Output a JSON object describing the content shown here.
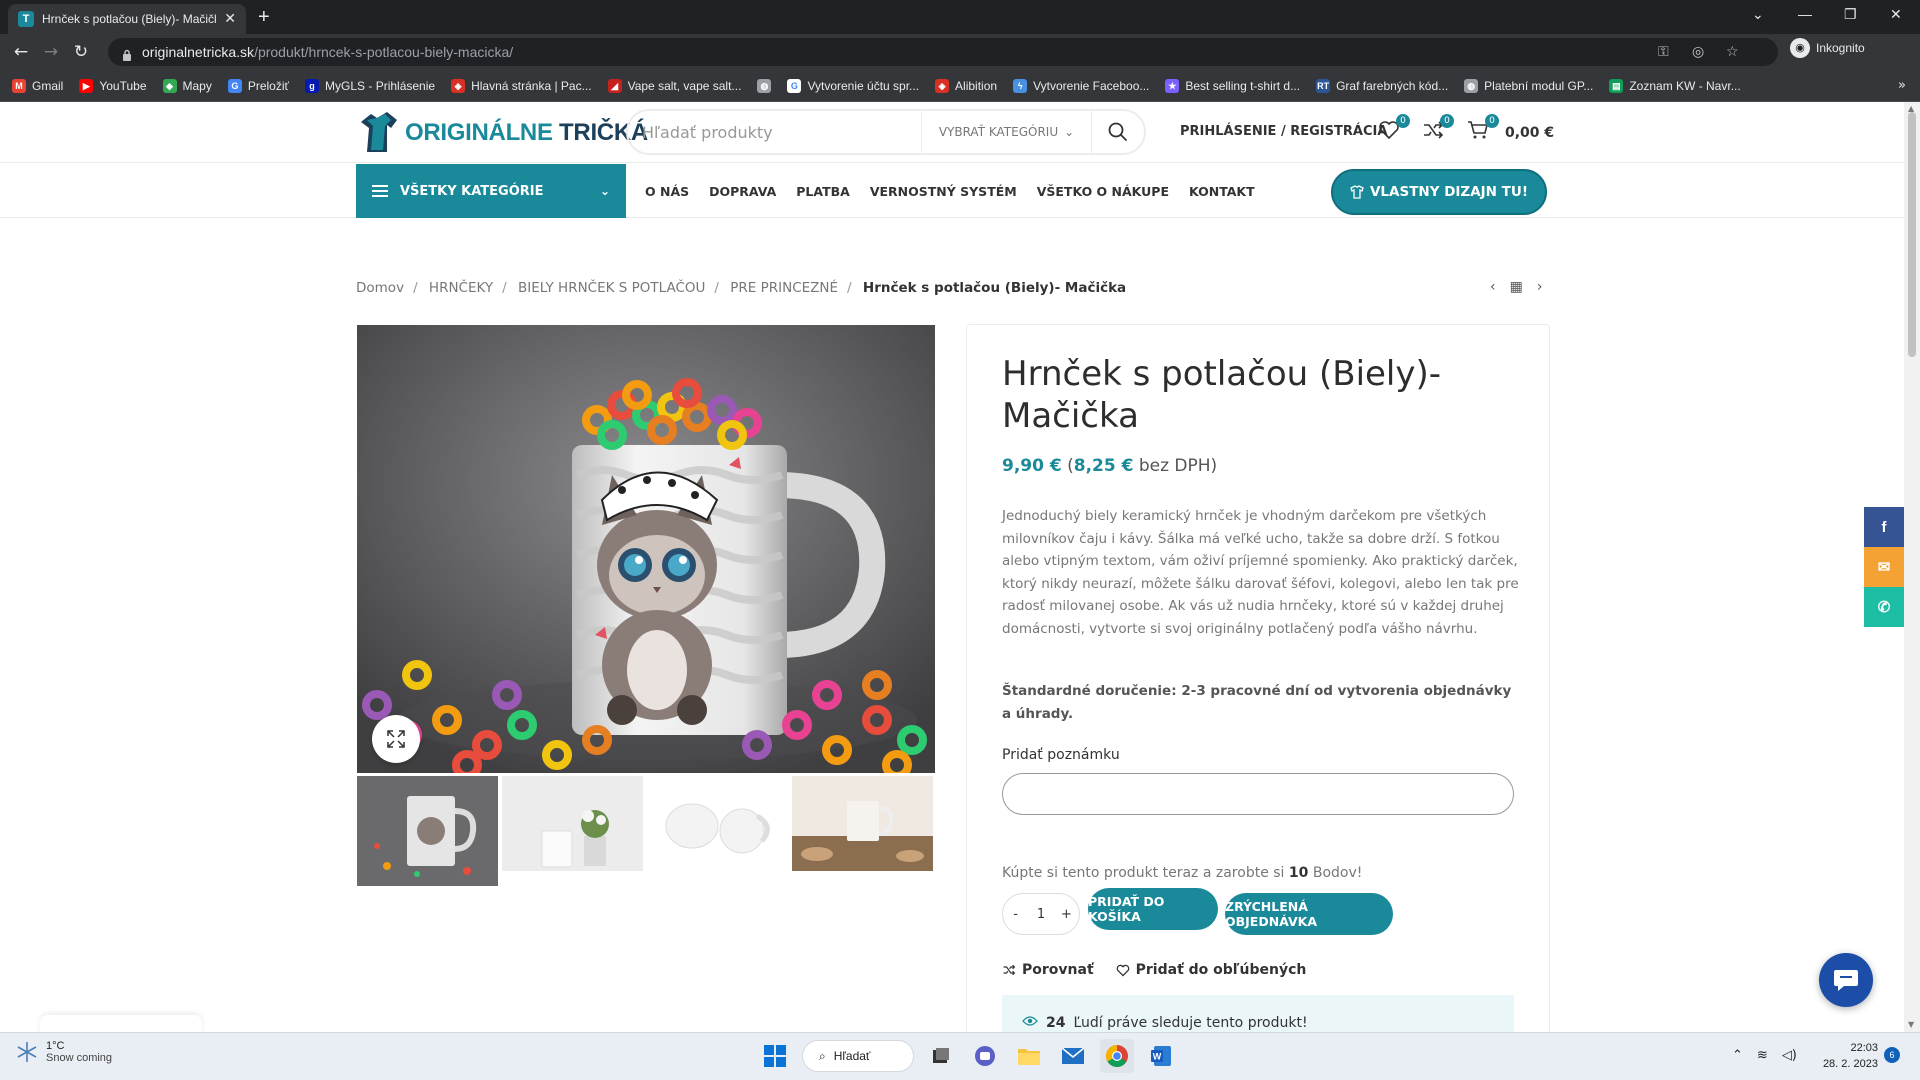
{
  "browser": {
    "tab_title": "Hrnček s potlačou (Biely)- Mačičk",
    "url_host": "originalnetricka.sk",
    "url_path": "/produkt/hrncek-s-potlacou-biely-macicka/",
    "profile_label": "Inkognito",
    "bookmarks": [
      {
        "label": "Gmail",
        "icon": "gmail-icon",
        "color": "#ea4335"
      },
      {
        "label": "YouTube",
        "icon": "youtube-icon",
        "color": "#ff0000"
      },
      {
        "label": "Mapy",
        "icon": "maps-icon",
        "color": "#34a853"
      },
      {
        "label": "Preložiť",
        "icon": "translate-icon",
        "color": "#4285f4"
      },
      {
        "label": "MyGLS - Prihlásenie",
        "icon": "gls-icon",
        "color": "#061ab1"
      },
      {
        "label": "Hlavná stránka | Pac...",
        "icon": "shield-icon",
        "color": "#d93025"
      },
      {
        "label": "Vape salt, vape salt...",
        "icon": "vape-icon",
        "color": "#c5221f"
      },
      {
        "label": "",
        "icon": "globe-icon",
        "color": "#9aa0a6"
      },
      {
        "label": "Vytvorenie účtu spr...",
        "icon": "google-icon",
        "color": "#ffffff"
      },
      {
        "label": "Alibition",
        "icon": "shield-icon",
        "color": "#d93025"
      },
      {
        "label": "Vytvorenie Faceboo...",
        "icon": "bolt-icon",
        "color": "#4a90e2"
      },
      {
        "label": "Best selling t-shirt d...",
        "icon": "star-icon",
        "color": "#7b61ff"
      },
      {
        "label": "Graf farebných kód...",
        "icon": "rt-icon",
        "color": "#2b5797"
      },
      {
        "label": "Platební modul GP...",
        "icon": "globe-icon",
        "color": "#9aa0a6"
      },
      {
        "label": "Zoznam KW - Navr...",
        "icon": "sheets-icon",
        "color": "#0f9d58"
      }
    ]
  },
  "header": {
    "logo_part1": "ORIGINÁLNE",
    "logo_part2": "TRIČKÁ",
    "search_placeholder": "Hľadať produkty",
    "category_select": "VYBRAŤ KATEGÓRIU",
    "login": "PRIHLÁSENIE / REGISTRÁCIA",
    "wishlist_count": "0",
    "compare_count": "0",
    "cart_count": "0",
    "cart_total": "0,00 €"
  },
  "nav": {
    "all_categories": "VŠETKY KATEGÓRIE",
    "menu": [
      "O NÁS",
      "DOPRAVA",
      "PLATBA",
      "VERNOSTNÝ SYSTÉM",
      "VŠETKO O NÁKUPE",
      "KONTAKT"
    ],
    "cta": "VLASTNY DIZAJN TU!"
  },
  "breadcrumb": {
    "items": [
      "Domov",
      "HRNČEKY",
      "BIELY HRNČEK S POTLAČOU",
      "PRE PRINCEZNÉ"
    ],
    "current": "Hrnček s potlačou (Biely)- Mačička"
  },
  "product": {
    "title": "Hrnček s potlačou (Biely)- Mačička",
    "price": "9,90 €",
    "price_net": "8,25 €",
    "price_net_suffix": "bez DPH)",
    "price_open": "(",
    "description": "Jednoduchý biely keramický hrnček je vhodným darčekom pre všetkých milovníkov čaju i kávy. Šálka má veľké ucho, takže sa dobre drží. S fotkou alebo vtipným textom, vám oživí príjemné spomienky. Ako praktický darček, ktorý nikdy neurazí, môžete šálku darovať šéfovi, kolegovi, alebo len tak pre radosť milovanej osobe. Ak vás už nudia hrnčeky, ktoré sú v každej druhej domácnosti, vytvorte si svoj originálny potlačený podľa vášho návrhu.",
    "delivery": "Štandardné doručenie: 2-3 pracovné dní od vytvorenia objednávky a úhrady.",
    "note_label": "Pridať poznámku",
    "points_prefix": "Kúpte si tento produkt teraz a zarobte si",
    "points_value": "10",
    "points_suffix": "Bodov!",
    "qty_minus": "-",
    "qty_value": "1",
    "qty_plus": "+",
    "add_to_cart": "PRIDAŤ DO KOŠÍKA",
    "quick_order": "ZRÝCHLENÁ OBJEDNÁVKA",
    "compare": "Porovnať",
    "wishlist": "Pridať do obľúbených",
    "viewers_count": "24",
    "viewers_text": "Ľudí práve sleduje tento produkt!"
  },
  "social": [
    {
      "icon": "facebook-icon",
      "color": "#365493",
      "glyph": "f"
    },
    {
      "icon": "email-icon",
      "color": "#f3a233",
      "glyph": "✉"
    },
    {
      "icon": "whatsapp-icon",
      "color": "#1ebea5",
      "glyph": "✆"
    }
  ],
  "taskbar": {
    "temperature": "1°C",
    "weather": "Snow coming",
    "search_label": "Hľadať",
    "time": "22:03",
    "date": "28. 2. 2023",
    "notifications": "6"
  },
  "colors": {
    "accent": "#1a8a9a",
    "dark_blue": "#1c3f5a"
  }
}
